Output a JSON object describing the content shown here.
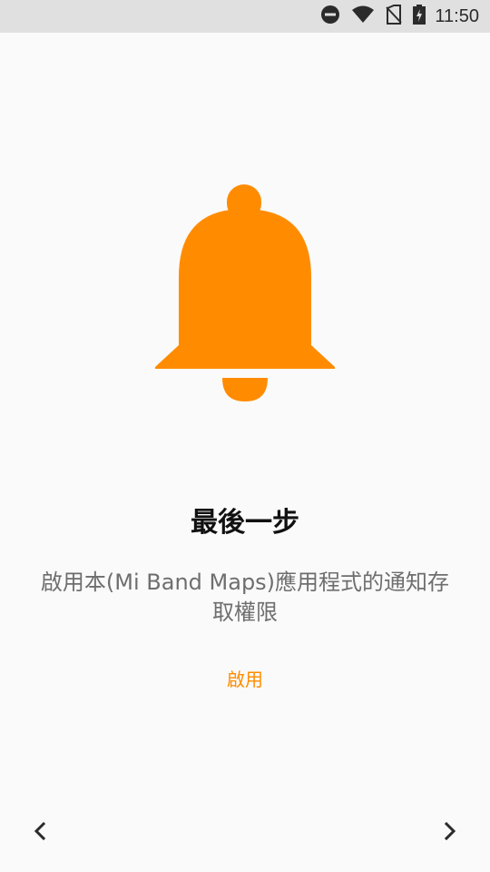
{
  "status_bar": {
    "time": "11:50",
    "icons": [
      "do-not-disturb-icon",
      "wifi-icon",
      "no-sim-icon",
      "battery-charging-icon"
    ]
  },
  "onboarding": {
    "icon": "bell-icon",
    "title": "最後一步",
    "description": "啟用本(Mi Band Maps)應用程式的通知存取權限",
    "enable_label": "啟用"
  },
  "navigation": {
    "prev_icon": "chevron-left-icon",
    "next_icon": "chevron-right-icon"
  },
  "colors": {
    "accent": "#ff8c00",
    "background": "#fafafa",
    "status_bar": "#e0e0e0",
    "title": "#111111",
    "description": "#6e6e6e"
  }
}
